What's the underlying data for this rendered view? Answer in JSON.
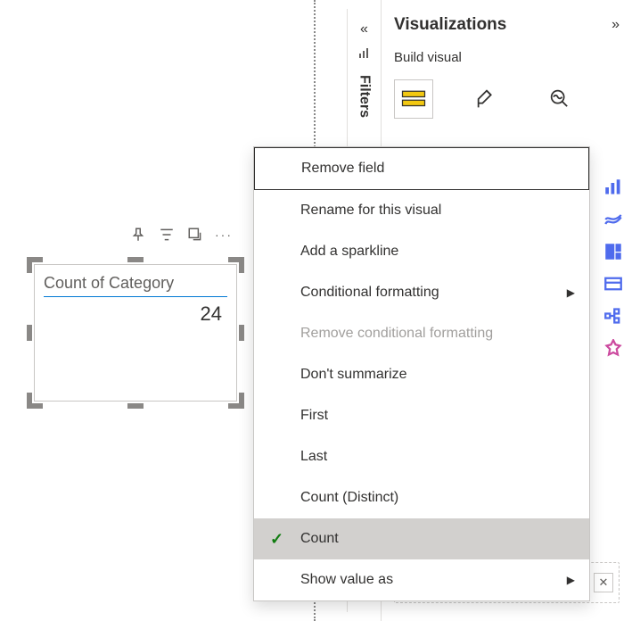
{
  "card": {
    "title": "Count of Category",
    "value": "24"
  },
  "filters_strip": {
    "label": "Filters"
  },
  "panel": {
    "title": "Visualizations",
    "subtitle": "Build visual"
  },
  "context_menu": {
    "items": [
      {
        "label": "Remove field",
        "current": true
      },
      {
        "label": "Rename for this visual"
      },
      {
        "label": "Add a sparkline"
      },
      {
        "label": "Conditional formatting",
        "submenu": true
      },
      {
        "label": "Remove conditional formatting",
        "disabled": true
      },
      {
        "label": "Don't summarize"
      },
      {
        "label": "First"
      },
      {
        "label": "Last"
      },
      {
        "label": "Count (Distinct)"
      },
      {
        "label": "Count",
        "selected": true
      },
      {
        "label": "Show value as",
        "submenu": true
      }
    ]
  }
}
